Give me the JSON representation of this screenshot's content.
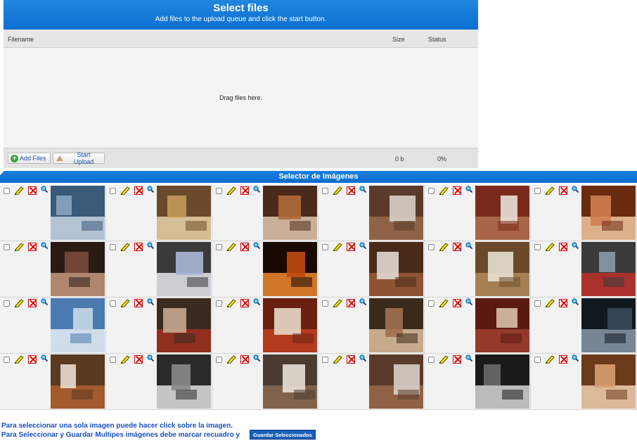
{
  "uploader": {
    "title": "Select files",
    "subtitle": "Add files to the upload queue and click the start button.",
    "columns": {
      "filename": "Filename",
      "size": "Size",
      "status": "Status"
    },
    "drop_text": "Drag files here.",
    "add_files_label": "Add Files",
    "start_upload_label": "Start Upload",
    "total_size": "0 b",
    "total_status": "0%"
  },
  "selector": {
    "title": "Selector de Imágenes",
    "info_line1": "Para seleccionar una sola imagen puede hacer click sobre la imagen.",
    "info_line2": "Para Seleccionar y Guardar Multipes imágenes debe marcar recuadro y",
    "save_label": "Guardar Seleccionados",
    "rows": 4,
    "cols": 6,
    "thumbs": [
      "glass-building-exterior-photo",
      "hotel-corridor-photo",
      "hotel-lobby-sofa-photo",
      "hotel-bedroom-photo",
      "hotel-room-window-photo",
      "spa-massage-photo",
      "hotel-room-dark-photo",
      "restaurant-interior-photo",
      "building-night-photo",
      "hotel-bedroom-photo",
      "hotel-bedroom-photo",
      "hotel-exterior-street-photo",
      "curved-building-photo",
      "reception-desk-photo",
      "hotel-room-red-photo",
      "hotel-room-desk-photo",
      "hotel-corridor-red-photo",
      "dark-room-sofa-photo",
      "hotel-suite-photo",
      "bathroom-photo",
      "hotel-bedroom-photo",
      "hotel-bedroom-photo",
      "dining-room-photo",
      "spa-room-photo"
    ]
  }
}
